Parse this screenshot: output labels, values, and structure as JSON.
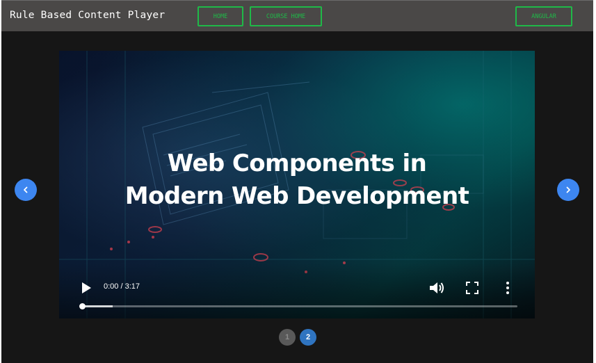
{
  "app": {
    "title": "Rule Based Content Player"
  },
  "nav": {
    "home_label": "HOME",
    "course_home_label": "COURSE HOME",
    "angular_label": "ANGULAR"
  },
  "video": {
    "title_line1": "Web Components in",
    "title_line2": "Modern Web Development",
    "time_display": "0:00 / 3:17",
    "progress_fraction": 0.0,
    "buffered_fraction": 0.07
  },
  "carousel": {
    "prev_icon": "chevron-left-icon",
    "next_icon": "chevron-right-icon",
    "pages": [
      "1",
      "2"
    ],
    "active_page": "2"
  },
  "colors": {
    "accent_green": "#1fb948",
    "header_bg": "#4a4847",
    "page_bg": "#161616",
    "arrow_blue": "#3d86f0",
    "active_page_blue": "#2f74c0"
  }
}
